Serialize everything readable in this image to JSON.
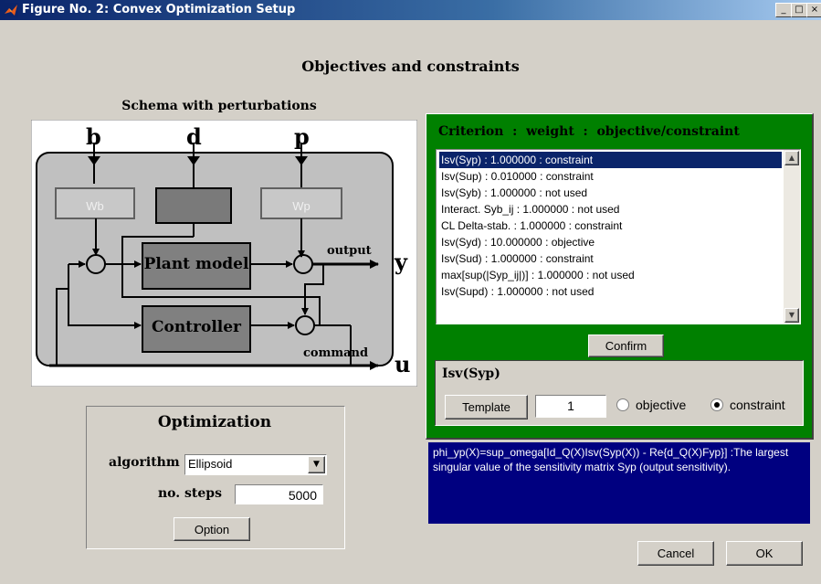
{
  "window": {
    "title": "Figure No. 2: Convex Optimization Setup",
    "controls": [
      "_",
      "□",
      "×"
    ]
  },
  "heading": "Objectives and constraints",
  "schema": {
    "title": "Schema with perturbations",
    "inputs": {
      "b": "b",
      "d": "d",
      "p": "p"
    },
    "blocks": {
      "wb": "Wb",
      "wp": "Wp",
      "plant": "Plant model",
      "controller": "Controller"
    },
    "signals": {
      "output": "output",
      "command": "command",
      "y": "y",
      "u": "u"
    }
  },
  "criteria": {
    "header": "Criterion  :  weight  :  objective/constraint",
    "items": [
      "Isv(Syp) : 1.000000 : constraint",
      "Isv(Sup) : 0.010000 : constraint",
      "Isv(Syb) : 1.000000 : not used",
      "Interact. Syb_ij : 1.000000 : not used",
      "CL Delta-stab. : 1.000000 : constraint",
      "Isv(Syd) : 10.000000 : objective",
      "Isv(Sud) : 1.000000 : constraint",
      "max[sup(|Syp_ij|)] : 1.000000 : not used",
      "Isv(Supd) : 1.000000 : not used"
    ],
    "selected_index": 0,
    "confirm_label": "Confirm"
  },
  "detail": {
    "name": "Isv(Syp)",
    "template_label": "Template",
    "weight_value": "1",
    "objective_label": "objective",
    "constraint_label": "constraint",
    "selected": "constraint"
  },
  "description": "phi_yp(X)=sup_omega[Id_Q(X)Isv(Syp(X)) - Re{d_Q(X)Fyp}] :The largest singular value of the sensitivity matrix Syp (output sensitivity).",
  "optimization": {
    "title": "Optimization",
    "algorithm_label": "algorithm",
    "algorithm_value": "Ellipsoid",
    "steps_label": "no. steps",
    "steps_value": "5000",
    "option_label": "Option"
  },
  "buttons": {
    "cancel": "Cancel",
    "ok": "OK"
  },
  "colors": {
    "criteria_panel": "#008000",
    "info_panel": "#000080",
    "selection": "#0a246a",
    "title_bar": "#0a246a"
  }
}
